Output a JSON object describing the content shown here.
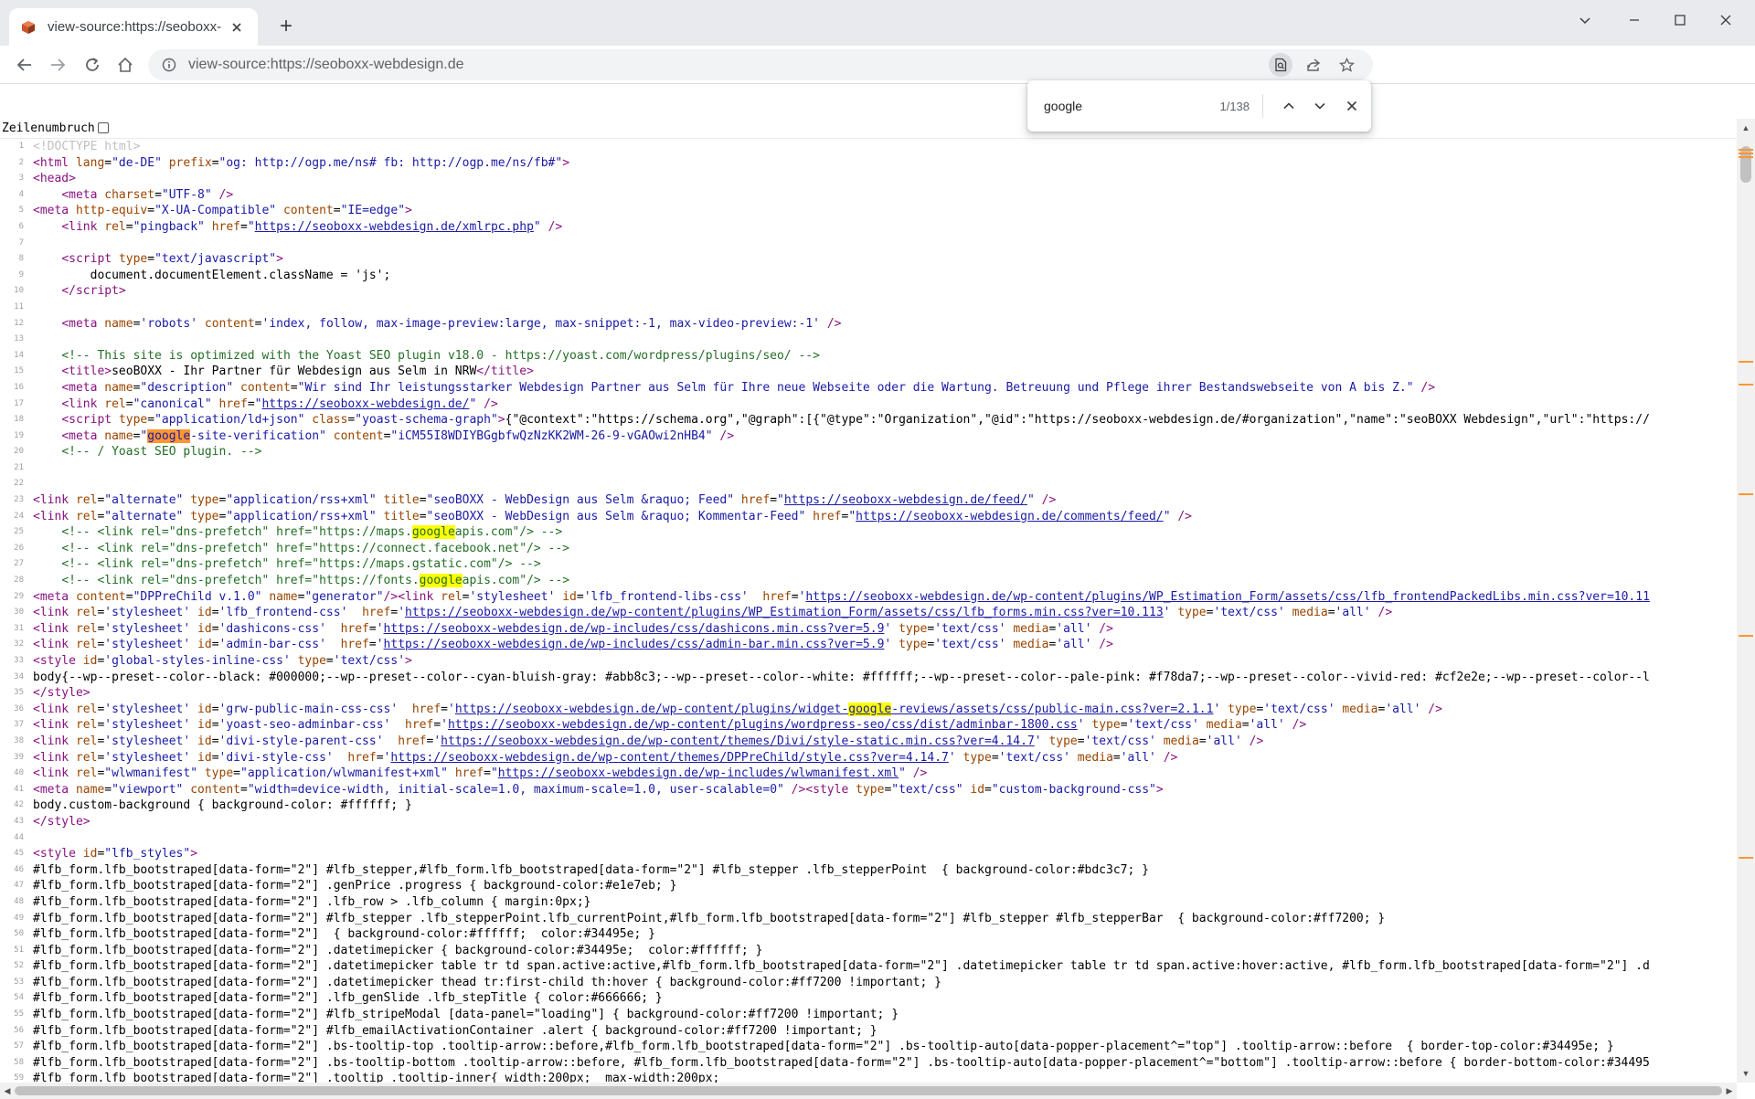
{
  "browser": {
    "tab_title": "view-source:https://seoboxx-webdesign.de",
    "tab_close_icon": "close-icon",
    "new_tab_label": "+",
    "url": "view-source:https://seoboxx-webdesign.de",
    "colors": {
      "titlebar": "#e8eaed",
      "omnibox": "#f1f3f4",
      "accent": "#1a73e8"
    }
  },
  "find": {
    "query": "google",
    "count": "1/138",
    "current_color": "#ff9632",
    "match_color": "#ffff00"
  },
  "wrap": {
    "label": "Zeilenumbruch",
    "checked": false
  },
  "source": {
    "lines": [
      {
        "n": "1",
        "html": "<span class=\"dt\">&lt;!DOCTYPE html&gt;</span>"
      },
      {
        "n": "2",
        "html": "<span class=\"tag\">&lt;html</span> <span class=\"an\">lang</span>=<span class=\"av\">\"de-DE\"</span> <span class=\"an\">prefix</span>=<span class=\"av\">\"og: http://ogp.me/ns# fb: http://ogp.me/ns/fb#\"</span><span class=\"tag\">&gt;</span>"
      },
      {
        "n": "3",
        "html": "<span class=\"tag\">&lt;head&gt;</span>"
      },
      {
        "n": "4",
        "html": "    <span class=\"tag\">&lt;meta</span> <span class=\"an\">charset</span>=<span class=\"av\">\"UTF-8\"</span> <span class=\"tag\">/&gt;</span>"
      },
      {
        "n": "5",
        "html": "<span class=\"tag\">&lt;meta</span> <span class=\"an\">http-equiv</span>=<span class=\"av\">\"X-UA-Compatible\"</span> <span class=\"an\">content</span>=<span class=\"av\">\"IE=edge\"</span><span class=\"tag\">&gt;</span>"
      },
      {
        "n": "6",
        "html": "    <span class=\"tag\">&lt;link</span> <span class=\"an\">rel</span>=<span class=\"av\">\"pingback\"</span> <span class=\"an\">href</span>=<span class=\"av\">\"</span><span class=\"lk\">https://seoboxx-webdesign.de/xmlrpc.php</span><span class=\"av\">\"</span> <span class=\"tag\">/&gt;</span>"
      },
      {
        "n": "7",
        "html": ""
      },
      {
        "n": "8",
        "html": "    <span class=\"tag\">&lt;script</span> <span class=\"an\">type</span>=<span class=\"av\">\"text/javascript\"</span><span class=\"tag\">&gt;</span>"
      },
      {
        "n": "9",
        "html": "        document.documentElement.className = 'js';"
      },
      {
        "n": "10",
        "html": "    <span class=\"tag\">&lt;/script&gt;</span>"
      },
      {
        "n": "11",
        "html": ""
      },
      {
        "n": "12",
        "html": "    <span class=\"tag\">&lt;meta</span> <span class=\"an\">name</span>=<span class=\"av\">'robots'</span> <span class=\"an\">content</span>=<span class=\"av\">'index, follow, max-image-preview:large, max-snippet:-1, max-video-preview:-1'</span> <span class=\"tag\">/&gt;</span>"
      },
      {
        "n": "13",
        "html": ""
      },
      {
        "n": "14",
        "html": "    <span class=\"cm\">&lt;!-- This site is optimized with the Yoast SEO plugin v18.0 - https://yoast.com/wordpress/plugins/seo/ --&gt;</span>"
      },
      {
        "n": "15",
        "html": "    <span class=\"tag\">&lt;title&gt;</span>seoBOXX - Ihr Partner für Webdesign aus Selm in NRW<span class=\"tag\">&lt;/title&gt;</span>"
      },
      {
        "n": "16",
        "html": "    <span class=\"tag\">&lt;meta</span> <span class=\"an\">name</span>=<span class=\"av\">\"description\"</span> <span class=\"an\">content</span>=<span class=\"av\">\"Wir sind Ihr leistungsstarker Webdesign Partner aus Selm für Ihre neue Webseite oder die Wartung. Betreuung und Pflege ihrer Bestandswebseite von A bis Z.\"</span> <span class=\"tag\">/&gt;</span>"
      },
      {
        "n": "17",
        "html": "    <span class=\"tag\">&lt;link</span> <span class=\"an\">rel</span>=<span class=\"av\">\"canonical\"</span> <span class=\"an\">href</span>=<span class=\"av\">\"</span><span class=\"lk\">https://seoboxx-webdesign.de/</span><span class=\"av\">\"</span> <span class=\"tag\">/&gt;</span>"
      },
      {
        "n": "18",
        "html": "    <span class=\"tag\">&lt;script</span> <span class=\"an\">type</span>=<span class=\"av\">\"application/ld+json\"</span> <span class=\"an\">class</span>=<span class=\"av\">\"yoast-schema-graph\"</span><span class=\"tag\">&gt;</span>{\"@context\":\"https://schema.org\",\"@graph\":[{\"@type\":\"Organization\",\"@id\":\"https://seoboxx-webdesign.de/#organization\",\"name\":\"seoBOXX Webdesign\",\"url\":\"https://"
      },
      {
        "n": "19",
        "html": "    <span class=\"tag\">&lt;meta</span> <span class=\"an\">name</span>=<span class=\"av\">\"<span class=\"hlc\">google</span>-site-verification\"</span> <span class=\"an\">content</span>=<span class=\"av\">\"iCM55I8WDIYBGgbfwQzNzKK2WM-26-9-vGAOwi2nHB4\"</span> <span class=\"tag\">/&gt;</span>"
      },
      {
        "n": "20",
        "html": "    <span class=\"cm\">&lt;!-- / Yoast SEO plugin. --&gt;</span>"
      },
      {
        "n": "21",
        "html": ""
      },
      {
        "n": "22",
        "html": ""
      },
      {
        "n": "23",
        "html": "<span class=\"tag\">&lt;link</span> <span class=\"an\">rel</span>=<span class=\"av\">\"alternate\"</span> <span class=\"an\">type</span>=<span class=\"av\">\"application/rss+xml\"</span> <span class=\"an\">title</span>=<span class=\"av\">\"seoBOXX - WebDesign aus Selm &amp;raquo; Feed\"</span> <span class=\"an\">href</span>=<span class=\"av\">\"</span><span class=\"lk\">https://seoboxx-webdesign.de/feed/</span><span class=\"av\">\"</span> <span class=\"tag\">/&gt;</span>"
      },
      {
        "n": "24",
        "html": "<span class=\"tag\">&lt;link</span> <span class=\"an\">rel</span>=<span class=\"av\">\"alternate\"</span> <span class=\"an\">type</span>=<span class=\"av\">\"application/rss+xml\"</span> <span class=\"an\">title</span>=<span class=\"av\">\"seoBOXX - WebDesign aus Selm &amp;raquo; Kommentar-Feed\"</span> <span class=\"an\">href</span>=<span class=\"av\">\"</span><span class=\"lk\">https://seoboxx-webdesign.de/comments/feed/</span><span class=\"av\">\"</span> <span class=\"tag\">/&gt;</span>"
      },
      {
        "n": "25",
        "html": "    <span class=\"cm\">&lt;!-- &lt;link rel=\"dns-prefetch\" href=\"https://maps.<span class=\"hl\">google</span>apis.com\"/&gt; --&gt;</span>"
      },
      {
        "n": "26",
        "html": "    <span class=\"cm\">&lt;!-- &lt;link rel=\"dns-prefetch\" href=\"https://connect.facebook.net\"/&gt; --&gt;</span>"
      },
      {
        "n": "27",
        "html": "    <span class=\"cm\">&lt;!-- &lt;link rel=\"dns-prefetch\" href=\"https://maps.gstatic.com\"/&gt; --&gt;</span>"
      },
      {
        "n": "28",
        "html": "    <span class=\"cm\">&lt;!-- &lt;link rel=\"dns-prefetch\" href=\"https://fonts.<span class=\"hl\">google</span>apis.com\"/&gt; --&gt;</span>"
      },
      {
        "n": "29",
        "html": "<span class=\"tag\">&lt;meta</span> <span class=\"an\">content</span>=<span class=\"av\">\"DPPreChild v.1.0\"</span> <span class=\"an\">name</span>=<span class=\"av\">\"generator\"</span><span class=\"tag\">/&gt;&lt;link</span> <span class=\"an\">rel</span>=<span class=\"av\">'stylesheet'</span> <span class=\"an\">id</span>=<span class=\"av\">'lfb_frontend-libs-css'</span>  <span class=\"an\">href</span>=<span class=\"av\">'</span><span class=\"lk\">https://seoboxx-webdesign.de/wp-content/plugins/WP_Estimation_Form/assets/css/lfb_frontendPackedLibs.min.css?ver=10.11</span>"
      },
      {
        "n": "30",
        "html": "<span class=\"tag\">&lt;link</span> <span class=\"an\">rel</span>=<span class=\"av\">'stylesheet'</span> <span class=\"an\">id</span>=<span class=\"av\">'lfb_frontend-css'</span>  <span class=\"an\">href</span>=<span class=\"av\">'</span><span class=\"lk\">https://seoboxx-webdesign.de/wp-content/plugins/WP_Estimation_Form/assets/css/lfb_forms.min.css?ver=10.113</span><span class=\"av\">'</span> <span class=\"an\">type</span>=<span class=\"av\">'text/css'</span> <span class=\"an\">media</span>=<span class=\"av\">'all'</span> <span class=\"tag\">/&gt;</span>"
      },
      {
        "n": "31",
        "html": "<span class=\"tag\">&lt;link</span> <span class=\"an\">rel</span>=<span class=\"av\">'stylesheet'</span> <span class=\"an\">id</span>=<span class=\"av\">'dashicons-css'</span>  <span class=\"an\">href</span>=<span class=\"av\">'</span><span class=\"lk\">https://seoboxx-webdesign.de/wp-includes/css/dashicons.min.css?ver=5.9</span><span class=\"av\">'</span> <span class=\"an\">type</span>=<span class=\"av\">'text/css'</span> <span class=\"an\">media</span>=<span class=\"av\">'all'</span> <span class=\"tag\">/&gt;</span>"
      },
      {
        "n": "32",
        "html": "<span class=\"tag\">&lt;link</span> <span class=\"an\">rel</span>=<span class=\"av\">'stylesheet'</span> <span class=\"an\">id</span>=<span class=\"av\">'admin-bar-css'</span>  <span class=\"an\">href</span>=<span class=\"av\">'</span><span class=\"lk\">https://seoboxx-webdesign.de/wp-includes/css/admin-bar.min.css?ver=5.9</span><span class=\"av\">'</span> <span class=\"an\">type</span>=<span class=\"av\">'text/css'</span> <span class=\"an\">media</span>=<span class=\"av\">'all'</span> <span class=\"tag\">/&gt;</span>"
      },
      {
        "n": "33",
        "html": "<span class=\"tag\">&lt;style</span> <span class=\"an\">id</span>=<span class=\"av\">'global-styles-inline-css'</span> <span class=\"an\">type</span>=<span class=\"av\">'text/css'</span><span class=\"tag\">&gt;</span>"
      },
      {
        "n": "34",
        "html": "body{--wp--preset--color--black: #000000;--wp--preset--color--cyan-bluish-gray: #abb8c3;--wp--preset--color--white: #ffffff;--wp--preset--color--pale-pink: #f78da7;--wp--preset--color--vivid-red: #cf2e2e;--wp--preset--color--l"
      },
      {
        "n": "35",
        "html": "<span class=\"tag\">&lt;/style&gt;</span>"
      },
      {
        "n": "36",
        "html": "<span class=\"tag\">&lt;link</span> <span class=\"an\">rel</span>=<span class=\"av\">'stylesheet'</span> <span class=\"an\">id</span>=<span class=\"av\">'grw-public-main-css-css'</span>  <span class=\"an\">href</span>=<span class=\"av\">'</span><span class=\"lk\">https://seoboxx-webdesign.de/wp-content/plugins/widget-<span class=\"hl\">google</span>-reviews/assets/css/public-main.css?ver=2.1.1</span><span class=\"av\">'</span> <span class=\"an\">type</span>=<span class=\"av\">'text/css'</span> <span class=\"an\">media</span>=<span class=\"av\">'all'</span> <span class=\"tag\">/&gt;</span>"
      },
      {
        "n": "37",
        "html": "<span class=\"tag\">&lt;link</span> <span class=\"an\">rel</span>=<span class=\"av\">'stylesheet'</span> <span class=\"an\">id</span>=<span class=\"av\">'yoast-seo-adminbar-css'</span>  <span class=\"an\">href</span>=<span class=\"av\">'</span><span class=\"lk\">https://seoboxx-webdesign.de/wp-content/plugins/wordpress-seo/css/dist/adminbar-1800.css</span><span class=\"av\">'</span> <span class=\"an\">type</span>=<span class=\"av\">'text/css'</span> <span class=\"an\">media</span>=<span class=\"av\">'all'</span> <span class=\"tag\">/&gt;</span>"
      },
      {
        "n": "38",
        "html": "<span class=\"tag\">&lt;link</span> <span class=\"an\">rel</span>=<span class=\"av\">'stylesheet'</span> <span class=\"an\">id</span>=<span class=\"av\">'divi-style-parent-css'</span>  <span class=\"an\">href</span>=<span class=\"av\">'</span><span class=\"lk\">https://seoboxx-webdesign.de/wp-content/themes/Divi/style-static.min.css?ver=4.14.7</span><span class=\"av\">'</span> <span class=\"an\">type</span>=<span class=\"av\">'text/css'</span> <span class=\"an\">media</span>=<span class=\"av\">'all'</span> <span class=\"tag\">/&gt;</span>"
      },
      {
        "n": "39",
        "html": "<span class=\"tag\">&lt;link</span> <span class=\"an\">rel</span>=<span class=\"av\">'stylesheet'</span> <span class=\"an\">id</span>=<span class=\"av\">'divi-style-css'</span>  <span class=\"an\">href</span>=<span class=\"av\">'</span><span class=\"lk\">https://seoboxx-webdesign.de/wp-content/themes/DPPreChild/style.css?ver=4.14.7</span><span class=\"av\">'</span> <span class=\"an\">type</span>=<span class=\"av\">'text/css'</span> <span class=\"an\">media</span>=<span class=\"av\">'all'</span> <span class=\"tag\">/&gt;</span>"
      },
      {
        "n": "40",
        "html": "<span class=\"tag\">&lt;link</span> <span class=\"an\">rel</span>=<span class=\"av\">\"wlwmanifest\"</span> <span class=\"an\">type</span>=<span class=\"av\">\"application/wlwmanifest+xml\"</span> <span class=\"an\">href</span>=<span class=\"av\">\"</span><span class=\"lk\">https://seoboxx-webdesign.de/wp-includes/wlwmanifest.xml</span><span class=\"av\">\"</span> <span class=\"tag\">/&gt;</span>"
      },
      {
        "n": "41",
        "html": "<span class=\"tag\">&lt;meta</span> <span class=\"an\">name</span>=<span class=\"av\">\"viewport\"</span> <span class=\"an\">content</span>=<span class=\"av\">\"width=device-width, initial-scale=1.0, maximum-scale=1.0, user-scalable=0\"</span> <span class=\"tag\">/&gt;&lt;style</span> <span class=\"an\">type</span>=<span class=\"av\">\"text/css\"</span> <span class=\"an\">id</span>=<span class=\"av\">\"custom-background-css\"</span><span class=\"tag\">&gt;</span>"
      },
      {
        "n": "42",
        "html": "body.custom-background { background-color: #ffffff; }"
      },
      {
        "n": "43",
        "html": "<span class=\"tag\">&lt;/style&gt;</span>"
      },
      {
        "n": "44",
        "html": ""
      },
      {
        "n": "45",
        "html": "<span class=\"tag\">&lt;style</span> <span class=\"an\">id</span>=<span class=\"av\">\"lfb_styles\"</span><span class=\"tag\">&gt;</span>"
      },
      {
        "n": "46",
        "html": "#lfb_form.lfb_bootstraped[data-form=\"2\"] #lfb_stepper,#lfb_form.lfb_bootstraped[data-form=\"2\"] #lfb_stepper .lfb_stepperPoint  { background-color:#bdc3c7; }"
      },
      {
        "n": "47",
        "html": "#lfb_form.lfb_bootstraped[data-form=\"2\"] .genPrice .progress { background-color:#e1e7eb; }"
      },
      {
        "n": "48",
        "html": "#lfb_form.lfb_bootstraped[data-form=\"2\"] .lfb_row &gt; .lfb_column { margin:0px;}"
      },
      {
        "n": "49",
        "html": "#lfb_form.lfb_bootstraped[data-form=\"2\"] #lfb_stepper .lfb_stepperPoint.lfb_currentPoint,#lfb_form.lfb_bootstraped[data-form=\"2\"] #lfb_stepper #lfb_stepperBar  { background-color:#ff7200; }"
      },
      {
        "n": "50",
        "html": "#lfb_form.lfb_bootstraped[data-form=\"2\"]  { background-color:#ffffff;  color:#34495e; }"
      },
      {
        "n": "51",
        "html": "#lfb_form.lfb_bootstraped[data-form=\"2\"] .datetimepicker { background-color:#34495e;  color:#ffffff; }"
      },
      {
        "n": "52",
        "html": "#lfb_form.lfb_bootstraped[data-form=\"2\"] .datetimepicker table tr td span.active:active,#lfb_form.lfb_bootstraped[data-form=\"2\"] .datetimepicker table tr td span.active:hover:active, #lfb_form.lfb_bootstraped[data-form=\"2\"] .d"
      },
      {
        "n": "53",
        "html": "#lfb_form.lfb_bootstraped[data-form=\"2\"] .datetimepicker thead tr:first-child th:hover { background-color:#ff7200 !important; }"
      },
      {
        "n": "54",
        "html": "#lfb_form.lfb_bootstraped[data-form=\"2\"] .lfb_genSlide .lfb_stepTitle { color:#666666; }"
      },
      {
        "n": "55",
        "html": "#lfb_form.lfb_bootstraped[data-form=\"2\"] #lfb_stripeModal [data-panel=\"loading\"] { background-color:#ff7200 !important; }"
      },
      {
        "n": "56",
        "html": "#lfb_form.lfb_bootstraped[data-form=\"2\"] #lfb_emailActivationContainer .alert { background-color:#ff7200 !important; }"
      },
      {
        "n": "57",
        "html": "#lfb_form.lfb_bootstraped[data-form=\"2\"] .bs-tooltip-top .tooltip-arrow::before,#lfb_form.lfb_bootstraped[data-form=\"2\"] .bs-tooltip-auto[data-popper-placement^=\"top\"] .tooltip-arrow::before  { border-top-color:#34495e; }"
      },
      {
        "n": "58",
        "html": "#lfb_form.lfb_bootstraped[data-form=\"2\"] .bs-tooltip-bottom .tooltip-arrow::before, #lfb_form.lfb_bootstraped[data-form=\"2\"] .bs-tooltip-auto[data-popper-placement^=\"bottom\"] .tooltip-arrow::before { border-bottom-color:#34495"
      },
      {
        "n": "59",
        "html": "#lfb_form.lfb_bootstraped[data-form=\"2\"] .tooltip .tooltip-inner{ width:200px;  max-width:200px;"
      }
    ]
  }
}
